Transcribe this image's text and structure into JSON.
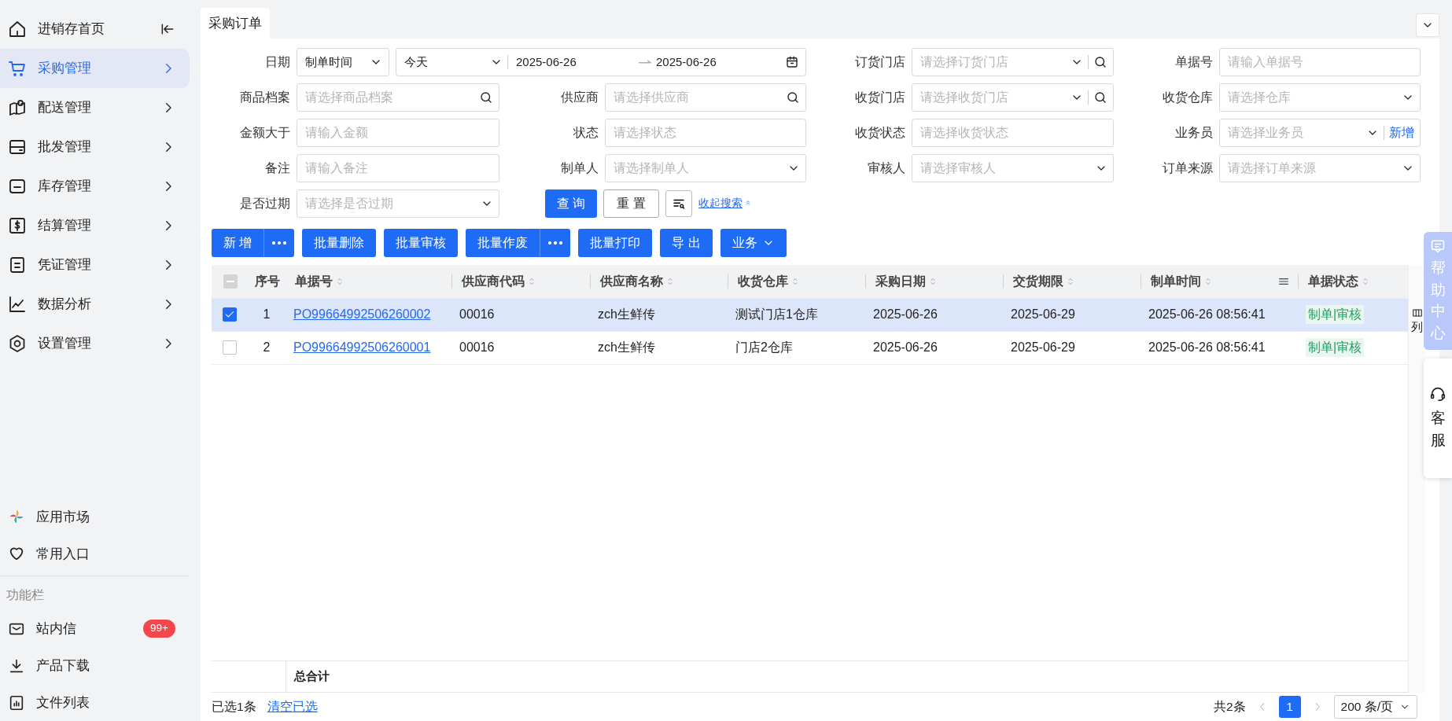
{
  "sidebar": {
    "items": [
      {
        "label": "进销存首页",
        "selected": false
      },
      {
        "label": "采购管理",
        "selected": true
      },
      {
        "label": "配送管理",
        "selected": false
      },
      {
        "label": "批发管理",
        "selected": false
      },
      {
        "label": "库存管理",
        "selected": false
      },
      {
        "label": "结算管理",
        "selected": false
      },
      {
        "label": "凭证管理",
        "selected": false
      },
      {
        "label": "数据分析",
        "selected": false
      },
      {
        "label": "设置管理",
        "selected": false
      }
    ],
    "shortcuts": [
      {
        "label": "应用市场"
      },
      {
        "label": "常用入口"
      }
    ],
    "section_title": "功能栏",
    "tools": [
      {
        "label": "站内信",
        "badge": "99+"
      },
      {
        "label": "产品下载"
      },
      {
        "label": "文件列表"
      }
    ]
  },
  "tabs": [
    {
      "label": "采购订单",
      "selected": true
    }
  ],
  "filters": [
    {
      "label": "日期",
      "kind": "daterange",
      "type_value": "制单时间",
      "preset_value": "今天",
      "start": "2025-06-26",
      "end": "2025-06-26"
    },
    {
      "label": "订货门店",
      "kind": "select-search",
      "placeholder": "请选择订货门店"
    },
    {
      "label": "单据号",
      "kind": "input",
      "placeholder": "请输入单据号"
    },
    {
      "label": "商品档案",
      "kind": "search",
      "placeholder": "请选择商品档案"
    },
    {
      "label": "供应商",
      "kind": "search",
      "placeholder": "请选择供应商"
    },
    {
      "label": "收货门店",
      "kind": "select-search",
      "placeholder": "请选择收货门店"
    },
    {
      "label": "收货仓库",
      "kind": "select",
      "placeholder": "请选择仓库"
    },
    {
      "label": "金额大于",
      "kind": "input",
      "placeholder": "请输入金额"
    },
    {
      "label": "状态",
      "kind": "input",
      "placeholder": "请选择状态"
    },
    {
      "label": "收货状态",
      "kind": "input",
      "placeholder": "请选择收货状态"
    },
    {
      "label": "业务员",
      "kind": "select-add",
      "placeholder": "请选择业务员",
      "add_label": "新增"
    },
    {
      "label": "备注",
      "kind": "input",
      "placeholder": "请输入备注"
    },
    {
      "label": "制单人",
      "kind": "select",
      "placeholder": "请选择制单人"
    },
    {
      "label": "审核人",
      "kind": "select",
      "placeholder": "请选择审核人"
    },
    {
      "label": "订单来源",
      "kind": "select",
      "placeholder": "请选择订单来源"
    },
    {
      "label": "是否过期",
      "kind": "select",
      "placeholder": "请选择是否过期"
    }
  ],
  "search_buttons": {
    "query": "查 询",
    "reset": "重 置",
    "collapse_link": "收起搜索"
  },
  "actions": [
    {
      "label": "新 增",
      "kind": "split"
    },
    {
      "label": "批量删除",
      "kind": "plain"
    },
    {
      "label": "批量审核",
      "kind": "plain"
    },
    {
      "label": "批量作废",
      "kind": "split"
    },
    {
      "label": "批量打印",
      "kind": "plain"
    },
    {
      "label": "导 出",
      "kind": "plain"
    },
    {
      "label": "业务",
      "kind": "dropdown"
    }
  ],
  "table": {
    "header_indeterminate": true,
    "columns": [
      {
        "label": "序号",
        "sortable": false
      },
      {
        "label": "单据号",
        "sortable": true
      },
      {
        "label": "供应商代码",
        "sortable": true
      },
      {
        "label": "供应商名称",
        "sortable": true
      },
      {
        "label": "收货仓库",
        "sortable": true
      },
      {
        "label": "采购日期",
        "sortable": true
      },
      {
        "label": "交货期限",
        "sortable": true
      },
      {
        "label": "制单时间",
        "sortable": true,
        "menu": true
      },
      {
        "label": "单据状态",
        "sortable": true
      }
    ],
    "rows": [
      {
        "selected": true,
        "cells": [
          "1",
          "PO99664992506260002",
          "00016",
          "zch生鲜传",
          "测试门店1仓库",
          "2025-06-26",
          "2025-06-29",
          "2025-06-26 08:56:41",
          "制单|审核"
        ]
      },
      {
        "selected": false,
        "cells": [
          "2",
          "PO99664992506260001",
          "00016",
          "zch生鲜传",
          "门店2仓库",
          "2025-06-26",
          "2025-06-29",
          "2025-06-26 08:56:41",
          "制单|审核"
        ]
      }
    ],
    "column_settings_label": "列",
    "total_label": "总合计"
  },
  "footer": {
    "selected_text": "已选1条",
    "clear_link": "清空已选",
    "total_text": "共2条",
    "pages": [
      {
        "label": "1",
        "selected": true
      }
    ],
    "page_size": "200 条/页"
  },
  "floating": {
    "help_label": "帮助中心",
    "service_label": "客服"
  }
}
